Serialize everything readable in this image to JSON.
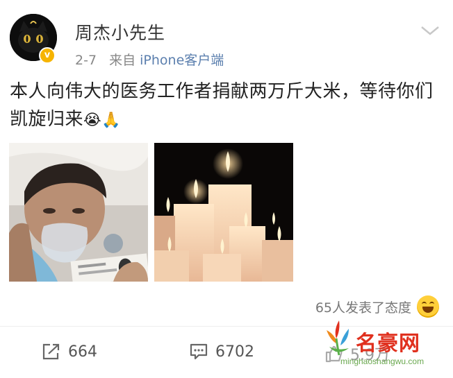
{
  "post": {
    "username": "周杰小先生",
    "time": "2-7",
    "source_prefix": "来自",
    "source": "iPhone客户端",
    "text": "本人向伟大的医务工作者捐献两万斤大米，等待你们凯旋归来",
    "emoji": "😭🙏",
    "images": [
      {
        "description_icon": "patient-photo"
      },
      {
        "description_icon": "candles-photo"
      }
    ],
    "reactions_text": "65人发表了态度",
    "repost_count": "664",
    "comment_count": "6702",
    "like_count": "5.9万"
  },
  "site_watermark": {
    "title": "名豪网",
    "url": "minghaoshangwu.com"
  },
  "colors": {
    "accent_link": "#5b7fae",
    "verified": "#f6b400",
    "watermark_red": "#e0301e",
    "watermark_green": "#6aa84f"
  }
}
